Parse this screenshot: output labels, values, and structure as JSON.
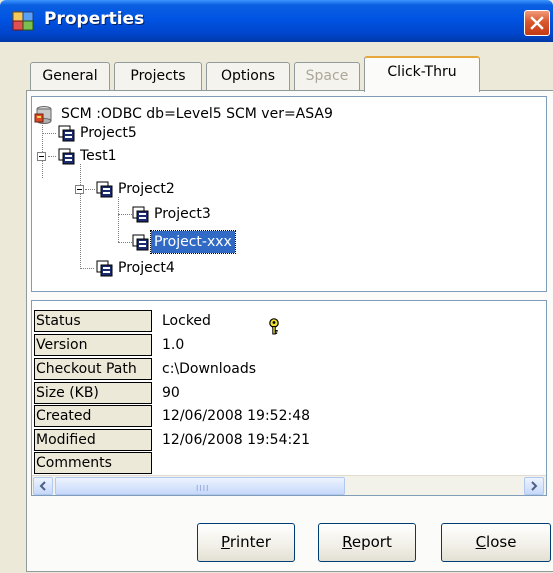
{
  "window": {
    "title": "Properties",
    "icon": "properties-icon",
    "close_icon": "close-icon",
    "close_color": "#d9582e"
  },
  "tabs": [
    {
      "label": "General",
      "state": "normal"
    },
    {
      "label": "Projects",
      "state": "normal"
    },
    {
      "label": "Options",
      "state": "normal"
    },
    {
      "label": "Space",
      "state": "disabled"
    },
    {
      "label": "Click-Thru",
      "state": "active"
    }
  ],
  "tree": {
    "root": "SCM :ODBC db=Level5 SCM ver=ASA9",
    "nodes": [
      {
        "label": "Project5",
        "selected": false
      },
      {
        "label": "Test1",
        "selected": false
      },
      {
        "label": "Project2",
        "selected": false
      },
      {
        "label": "Project3",
        "selected": false
      },
      {
        "label": "Project-xxx",
        "selected": true
      },
      {
        "label": "Project4",
        "selected": false
      }
    ]
  },
  "properties": [
    {
      "name": "Status",
      "value": "Locked"
    },
    {
      "name": "Version",
      "value": "1.0"
    },
    {
      "name": "Checkout Path",
      "value": "c:\\Downloads"
    },
    {
      "name": "Size (KB)",
      "value": "90"
    },
    {
      "name": "Created",
      "value": "12/06/2008 19:52:48"
    },
    {
      "name": "Modified",
      "value": "12/06/2008 19:54:21"
    },
    {
      "name": "Comments",
      "value": ""
    }
  ],
  "scrollbar": {
    "grip": "IIII"
  },
  "buttons": {
    "printer": {
      "first": "P",
      "rest": "rinter"
    },
    "report": {
      "first": "R",
      "rest": "eport"
    },
    "close": {
      "first": "C",
      "rest": "lose"
    }
  },
  "colors": {
    "titlebar": "#0054e3",
    "selection": "#316ac5",
    "active_tab_accent": "#e6a83a"
  }
}
